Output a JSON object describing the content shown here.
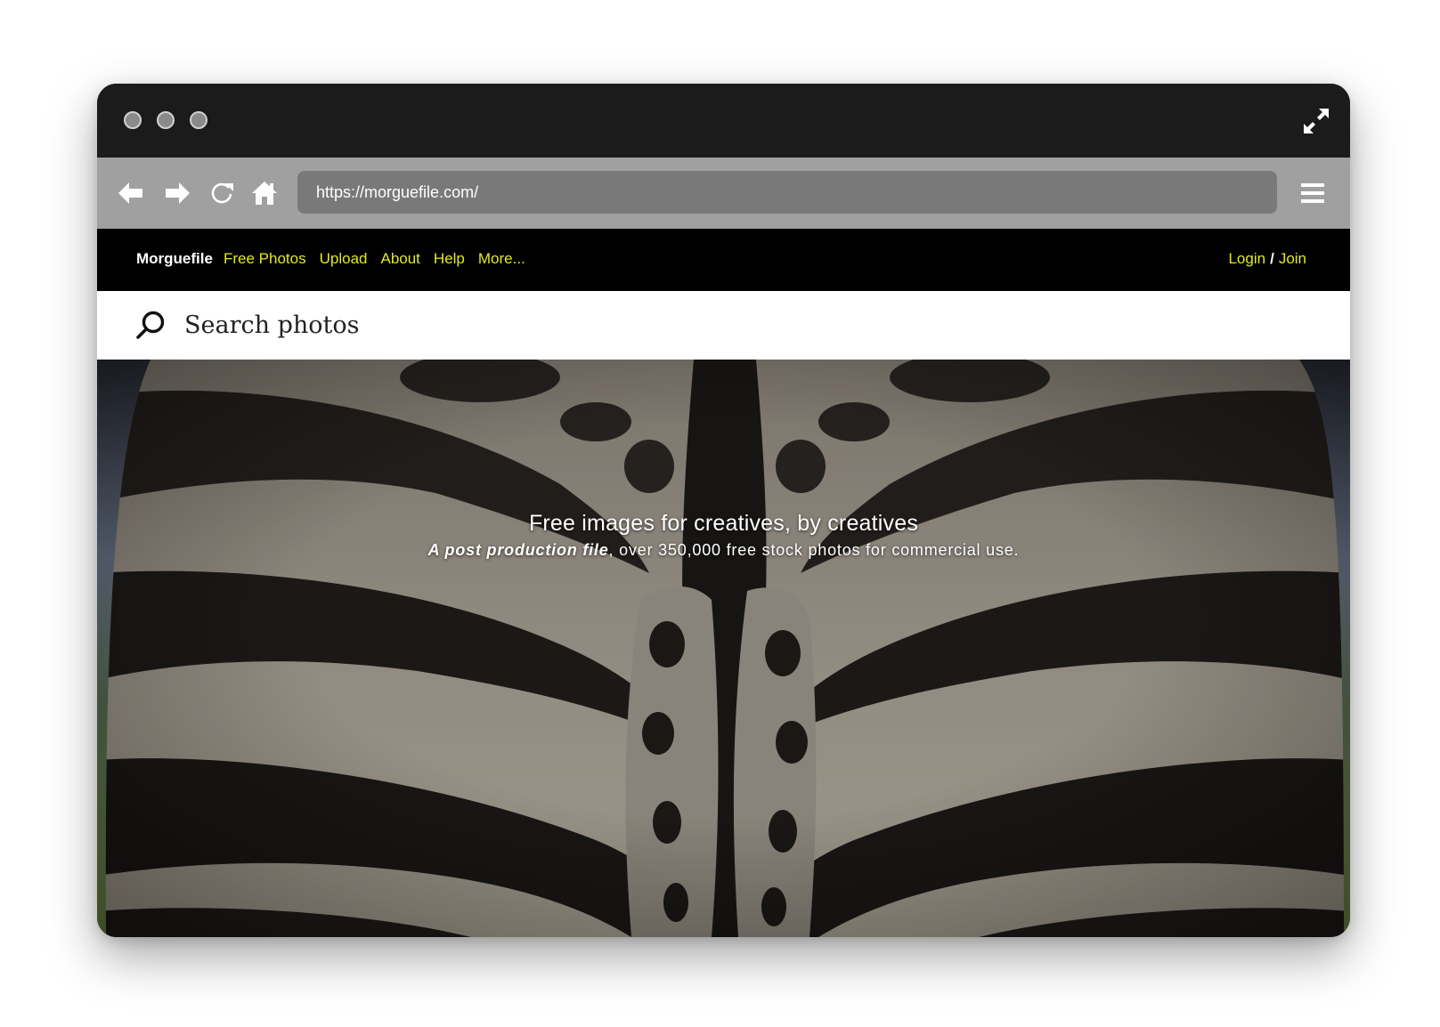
{
  "browser": {
    "url": "https://morguefile.com/"
  },
  "nav": {
    "brand": "Morguefile",
    "links": [
      "Free Photos",
      "Upload",
      "About",
      "Help",
      "More..."
    ],
    "login": "Login",
    "separator": "/",
    "join": "Join",
    "link_color": "#e2ea1f"
  },
  "search": {
    "placeholder": "Search photos"
  },
  "hero": {
    "title": "Free images for creatives, by creatives",
    "subtitle_em": "A post production file",
    "subtitle_rest": ", over 350,000 free stock photos for commercial use."
  },
  "icons": {
    "traffic_lights": [
      "window-dot",
      "window-dot",
      "window-dot"
    ],
    "expand": "expand-icon",
    "back": "back-arrow-icon",
    "forward": "forward-arrow-icon",
    "reload": "reload-icon",
    "home": "home-icon",
    "menu": "hamburger-menu-icon",
    "search": "search-icon"
  }
}
